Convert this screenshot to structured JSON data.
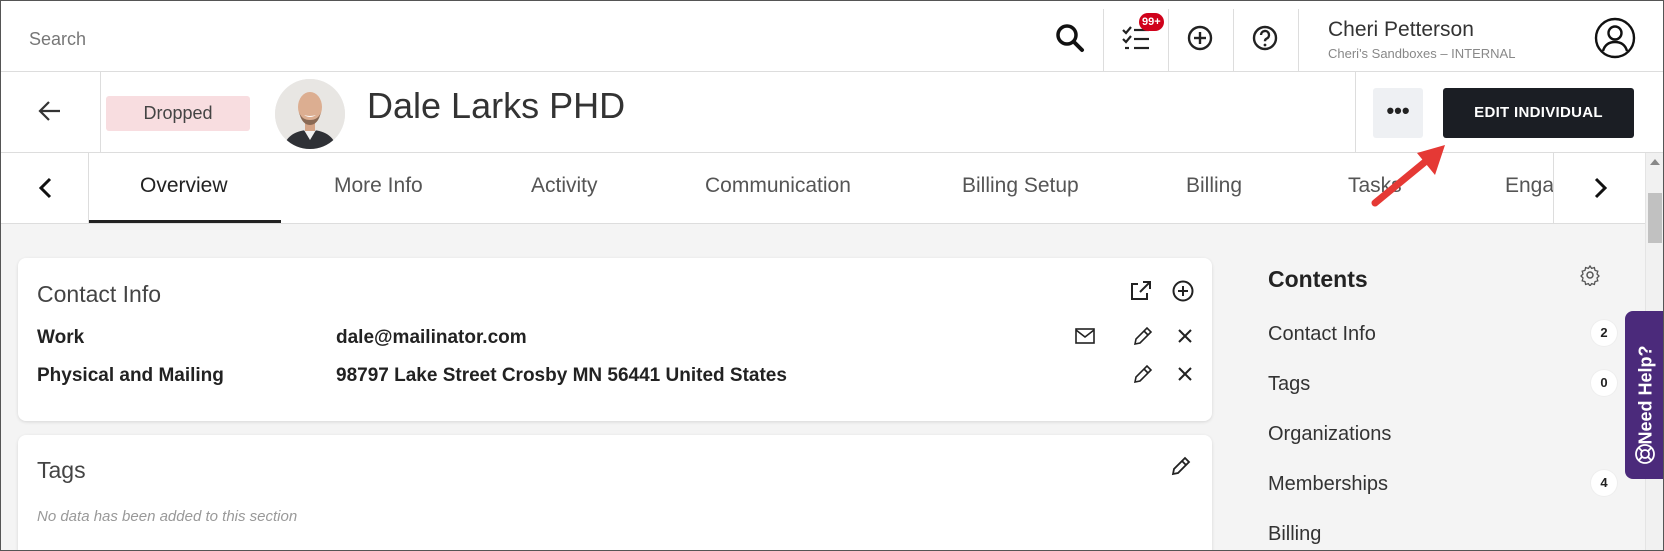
{
  "topbar": {
    "search_placeholder": "Search",
    "notification_count": "99+",
    "user_name": "Cheri Petterson",
    "user_org": "Cheri's Sandboxes – INTERNAL"
  },
  "header": {
    "status": "Dropped",
    "title": "Dale Larks PHD",
    "more_label": "•••",
    "edit_label": "EDIT INDIVIDUAL"
  },
  "tabs": [
    {
      "label": "Overview",
      "active": true
    },
    {
      "label": "More Info"
    },
    {
      "label": "Activity"
    },
    {
      "label": "Communication"
    },
    {
      "label": "Billing Setup"
    },
    {
      "label": "Billing"
    },
    {
      "label": "Tasks"
    },
    {
      "label": "Enga"
    }
  ],
  "contact_info": {
    "title": "Contact Info",
    "rows": [
      {
        "label": "Work",
        "value": "dale@mailinator.com"
      },
      {
        "label": "Physical and Mailing",
        "value": "98797 Lake Street Crosby MN 56441 United States"
      }
    ]
  },
  "tags": {
    "title": "Tags",
    "empty_text": "No data has been added to this section"
  },
  "contents": {
    "title": "Contents",
    "items": [
      {
        "label": "Contact Info",
        "count": "2"
      },
      {
        "label": "Tags",
        "count": "0"
      },
      {
        "label": "Organizations",
        "count": ""
      },
      {
        "label": "Memberships",
        "count": "4"
      },
      {
        "label": "Billing",
        "count": ""
      }
    ]
  },
  "help": {
    "label": "Need Help?"
  },
  "colors": {
    "status_bg": "#f8dde0",
    "edit_button_bg": "#1b1e24",
    "badge_red": "#d0021b",
    "help_purple": "#4b2a7b",
    "annotation_arrow": "#e53935"
  }
}
